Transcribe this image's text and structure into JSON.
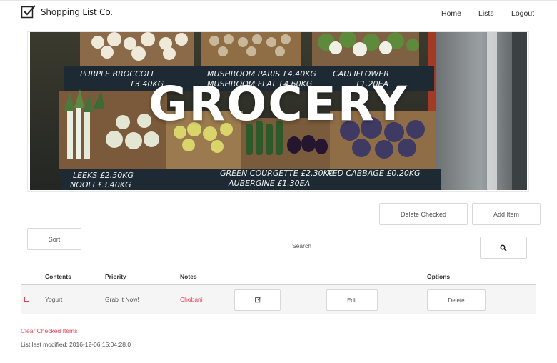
{
  "navbar": {
    "brand": "Shopping List Co.",
    "links": [
      "Home",
      "Lists",
      "Logout"
    ]
  },
  "hero": {
    "title": "GROCERY",
    "signs": {
      "top_left": "PURPLE BROCCOLI",
      "top_left_price": "£3.40KG",
      "top_mid": "MUSHROOM PARIS £4.40KG",
      "top_mid2": "MUSHROOM FLAT £4.60KG",
      "top_right": "CAULIFLOWER",
      "top_right_price": "£1.20EA",
      "bottom_left": "LEEKS £2.50KG",
      "bottom_left2": "NOOLI £3.40KG",
      "bottom_mid": "GREEN COURGETTE £2.30KG",
      "bottom_mid2": "AUBERGINE £1.30EA",
      "bottom_right": "RED CABBAGE £0.20KG"
    }
  },
  "actions": {
    "delete_checked": "Delete Checked",
    "add_item": "Add Item",
    "sort": "Sort",
    "search_label": "Search"
  },
  "table": {
    "headers": {
      "contents": "Contents",
      "priority": "Priority",
      "notes": "Notes",
      "options": "Options"
    },
    "rows": [
      {
        "contents": "Yogurt",
        "priority": "Grab It Now!",
        "notes": "Chobani",
        "edit_label": "Edit",
        "delete_label": "Delete"
      }
    ]
  },
  "footer": {
    "clear_checked": "Clear Checked Items",
    "last_modified": "List last modified: 2016-12-06 15:04:28.0"
  },
  "colors": {
    "accent": "#e8445f",
    "chalkboard": "#1f2a33",
    "hero_bg": "#2a3a2a"
  },
  "icons": {
    "brand": "checkbox-icon",
    "search": "search-icon",
    "row_edit_box": "edit-square-icon"
  }
}
